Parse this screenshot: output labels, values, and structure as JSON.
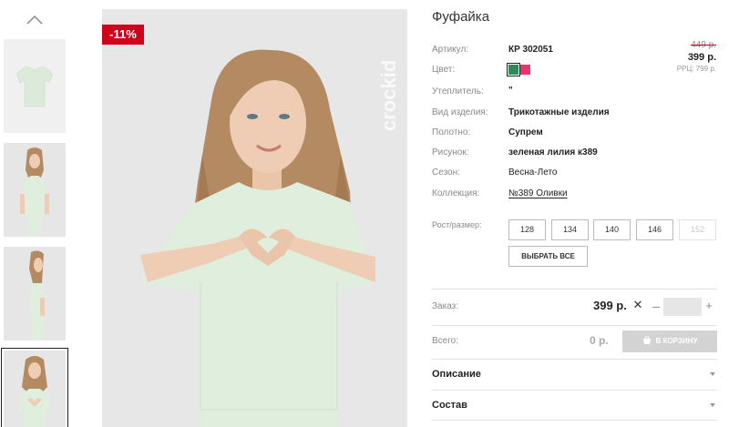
{
  "product": {
    "title": "Фуфайка",
    "discount_badge": "-11%",
    "watermark": "crockid"
  },
  "price": {
    "old": "449 р.",
    "current": "399 р.",
    "rrp": "РРЦ: 799 р."
  },
  "attributes": [
    {
      "label": "Артикул:",
      "value": "КР 302051"
    },
    {
      "label": "Цвет:",
      "value": ""
    },
    {
      "label": "Утеплитель:",
      "value": "\""
    },
    {
      "label": "Вид изделия:",
      "value": "Трикотажные изделия"
    },
    {
      "label": "Полотно:",
      "value": "Супрем"
    },
    {
      "label": "Рисунок:",
      "value": "зеленая лилия к389"
    },
    {
      "label": "Сезон:",
      "value": "Весна-Лето"
    },
    {
      "label": "Коллекция:",
      "value": "№389 Оливки"
    }
  ],
  "colors": [
    {
      "name": "green",
      "hex": "#2e8b57",
      "selected": true
    },
    {
      "name": "pink",
      "hex": "#e8336c",
      "selected": false
    }
  ],
  "sizes": {
    "label": "Рост/размер:",
    "options": [
      {
        "value": "128",
        "available": true
      },
      {
        "value": "134",
        "available": true
      },
      {
        "value": "140",
        "available": true
      },
      {
        "value": "146",
        "available": true
      },
      {
        "value": "152",
        "available": false
      }
    ],
    "select_all": "ВЫБРАТЬ ВСЕ"
  },
  "order": {
    "label": "Заказ:",
    "price": "399 р.",
    "times": "✕",
    "minus": "–",
    "plus": "+",
    "quantity": ""
  },
  "total": {
    "label": "Всего:",
    "value": "0 р.",
    "cart_button": "В КОРЗИНУ"
  },
  "accordion": [
    {
      "title": "Описание"
    },
    {
      "title": "Состав"
    }
  ],
  "thumbnails": {
    "count": 4,
    "active_index": 3
  },
  "colors_theme": {
    "badge": "#d0021b",
    "shirt": "#dfeedd",
    "background": "#e7e7e8",
    "cart_disabled": "#d3d3d3"
  }
}
